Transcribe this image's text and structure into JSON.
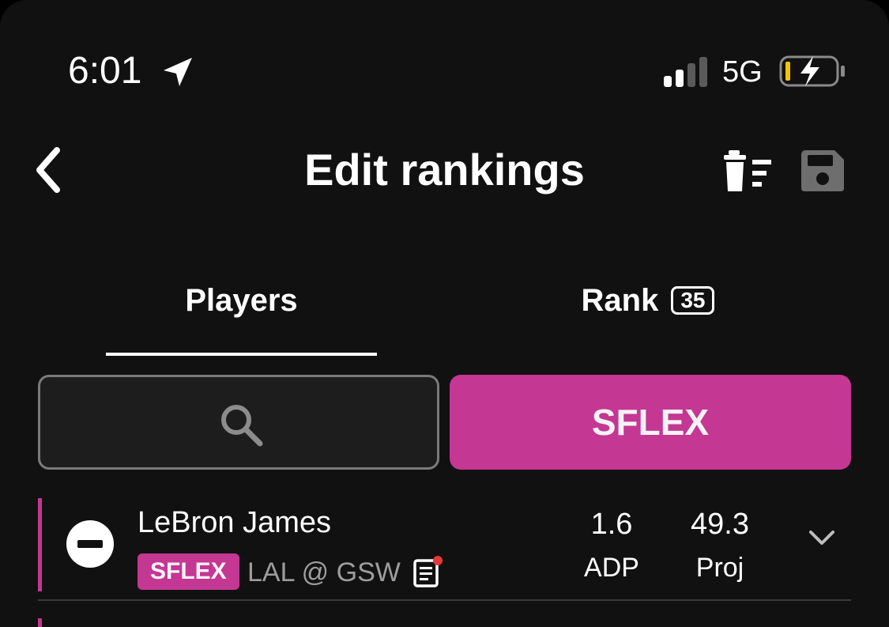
{
  "status_bar": {
    "time": "6:01",
    "network": "5G",
    "location_icon": "location-arrow-icon",
    "signal_icon": "cellular-signal-icon",
    "battery_icon": "battery-charging-icon"
  },
  "header": {
    "title": "Edit rankings",
    "back_icon": "chevron-left-icon",
    "clear_icon": "trash-list-icon",
    "save_icon": "floppy-disk-icon"
  },
  "tabs": [
    {
      "label": "Players",
      "active": true
    },
    {
      "label": "Rank",
      "badge": "35",
      "active": false
    }
  ],
  "search": {
    "placeholder": "",
    "value": "",
    "icon": "search-icon"
  },
  "filter": {
    "label": "SFLEX"
  },
  "players": [
    {
      "name": "LeBron James",
      "position": "SFLEX",
      "matchup": "LAL @ GSW",
      "has_news": true,
      "adp_value": "1.6",
      "adp_label": "ADP",
      "proj_value": "49.3",
      "proj_label": "Proj"
    }
  ],
  "colors": {
    "accent": "#c43793",
    "background": "#111111",
    "news_dot": "#e5383b",
    "battery_level": "#f5c400"
  }
}
